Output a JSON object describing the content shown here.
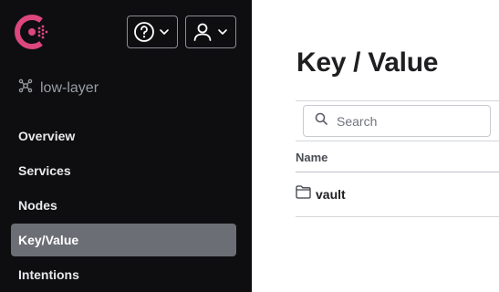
{
  "brand": {
    "logo_icon": "consul-logo-icon",
    "color": "#dc477d"
  },
  "header": {
    "help_icon": "help-circle-icon",
    "user_icon": "user-icon",
    "chevron_icon": "chevron-down-icon"
  },
  "datacenter": {
    "label": "low-layer",
    "icon": "datacenter-icon"
  },
  "sidebar": {
    "items": [
      {
        "label": "Overview",
        "active": false
      },
      {
        "label": "Services",
        "active": false
      },
      {
        "label": "Nodes",
        "active": false
      },
      {
        "label": "Key/Value",
        "active": true
      },
      {
        "label": "Intentions",
        "active": false
      }
    ]
  },
  "main": {
    "title": "Key / Value",
    "search": {
      "placeholder": "Search",
      "value": "",
      "icon": "search-icon"
    },
    "table": {
      "columns": [
        "Name"
      ],
      "rows": [
        {
          "name": "vault",
          "icon": "folder-icon"
        }
      ]
    }
  },
  "colors": {
    "sidebar_bg": "#0e0e11",
    "active_item_bg": "#6b6e75",
    "text_primary": "#1f1f22"
  }
}
